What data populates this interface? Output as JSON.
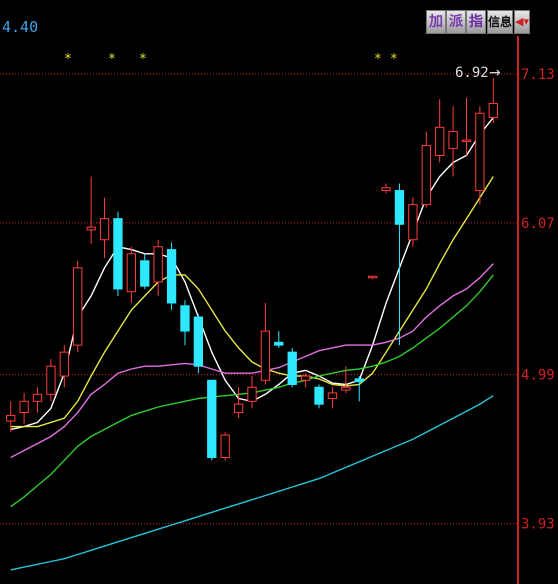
{
  "chart_data": {
    "type": "candlestick",
    "corner_value": "4.40",
    "y_ticks": [
      "7.13",
      "6.07",
      "4.99",
      "3.93"
    ],
    "ylim": [
      3.5,
      7.4
    ],
    "price_marker": "6.92",
    "star_marks": [
      "*",
      "*",
      "*",
      "*",
      "*"
    ],
    "candles": [
      {
        "o": 4.66,
        "h": 4.8,
        "l": 4.58,
        "c": 4.7
      },
      {
        "o": 4.72,
        "h": 4.86,
        "l": 4.64,
        "c": 4.8
      },
      {
        "o": 4.8,
        "h": 4.9,
        "l": 4.72,
        "c": 4.85
      },
      {
        "o": 4.85,
        "h": 5.1,
        "l": 4.8,
        "c": 5.05
      },
      {
        "o": 4.98,
        "h": 5.2,
        "l": 4.9,
        "c": 5.15
      },
      {
        "o": 5.2,
        "h": 5.8,
        "l": 5.15,
        "c": 5.75
      },
      {
        "o": 6.02,
        "h": 6.4,
        "l": 5.92,
        "c": 6.04
      },
      {
        "o": 5.95,
        "h": 6.25,
        "l": 5.82,
        "c": 6.1
      },
      {
        "o": 6.1,
        "h": 6.15,
        "l": 5.55,
        "c": 5.6
      },
      {
        "o": 5.58,
        "h": 5.9,
        "l": 5.5,
        "c": 5.85
      },
      {
        "o": 5.8,
        "h": 5.85,
        "l": 5.6,
        "c": 5.62
      },
      {
        "o": 5.65,
        "h": 5.95,
        "l": 5.55,
        "c": 5.9
      },
      {
        "o": 5.88,
        "h": 5.93,
        "l": 5.45,
        "c": 5.5
      },
      {
        "o": 5.48,
        "h": 5.52,
        "l": 5.2,
        "c": 5.3
      },
      {
        "o": 5.4,
        "h": 5.42,
        "l": 5.0,
        "c": 5.05
      },
      {
        "o": 4.95,
        "h": 4.95,
        "l": 4.38,
        "c": 4.4
      },
      {
        "o": 4.4,
        "h": 4.58,
        "l": 4.38,
        "c": 4.56
      },
      {
        "o": 4.72,
        "h": 4.9,
        "l": 4.68,
        "c": 4.78
      },
      {
        "o": 4.8,
        "h": 4.98,
        "l": 4.75,
        "c": 4.9
      },
      {
        "o": 4.95,
        "h": 5.5,
        "l": 4.92,
        "c": 5.3
      },
      {
        "o": 5.22,
        "h": 5.3,
        "l": 5.18,
        "c": 5.2
      },
      {
        "o": 5.15,
        "h": 5.18,
        "l": 4.9,
        "c": 4.92
      },
      {
        "o": 4.95,
        "h": 5.0,
        "l": 4.9,
        "c": 4.98
      },
      {
        "o": 4.9,
        "h": 4.92,
        "l": 4.75,
        "c": 4.78
      },
      {
        "o": 4.82,
        "h": 4.9,
        "l": 4.75,
        "c": 4.86
      },
      {
        "o": 4.88,
        "h": 5.05,
        "l": 4.86,
        "c": 4.9
      },
      {
        "o": 4.96,
        "h": 4.98,
        "l": 4.8,
        "c": 4.94
      },
      {
        "o": 5.68,
        "h": 5.69,
        "l": 5.67,
        "c": 5.69
      },
      {
        "o": 6.3,
        "h": 6.35,
        "l": 6.28,
        "c": 6.32
      },
      {
        "o": 6.3,
        "h": 6.35,
        "l": 5.2,
        "c": 6.06
      },
      {
        "o": 5.95,
        "h": 6.25,
        "l": 5.9,
        "c": 6.2
      },
      {
        "o": 6.2,
        "h": 6.72,
        "l": 6.18,
        "c": 6.62
      },
      {
        "o": 6.55,
        "h": 6.95,
        "l": 6.5,
        "c": 6.75
      },
      {
        "o": 6.6,
        "h": 6.9,
        "l": 6.4,
        "c": 6.72
      },
      {
        "o": 6.65,
        "h": 6.96,
        "l": 6.55,
        "c": 6.66
      },
      {
        "o": 6.3,
        "h": 6.9,
        "l": 6.2,
        "c": 6.85
      },
      {
        "o": 6.82,
        "h": 7.1,
        "l": 6.78,
        "c": 6.92
      }
    ],
    "series": [
      {
        "color": "#ffffff",
        "values": [
          4.6,
          4.62,
          4.65,
          4.75,
          5.0,
          5.4,
          5.55,
          5.75,
          5.9,
          5.88,
          5.85,
          5.85,
          5.82,
          5.65,
          5.4,
          5.15,
          4.95,
          4.82,
          4.8,
          4.85,
          4.92,
          5.0,
          5.02,
          4.98,
          4.93,
          4.92,
          4.95,
          5.2,
          5.5,
          5.75,
          6.0,
          6.25,
          6.4,
          6.5,
          6.55,
          6.7,
          6.82
        ]
      },
      {
        "color": "#e6e640",
        "values": [
          4.62,
          4.62,
          4.62,
          4.65,
          4.68,
          4.8,
          4.98,
          5.15,
          5.3,
          5.45,
          5.55,
          5.65,
          5.7,
          5.7,
          5.6,
          5.45,
          5.3,
          5.18,
          5.08,
          5.03,
          5.0,
          4.98,
          4.98,
          4.96,
          4.92,
          4.91,
          4.92,
          5.0,
          5.15,
          5.3,
          5.45,
          5.6,
          5.78,
          5.95,
          6.1,
          6.25,
          6.4
        ]
      },
      {
        "color": "#e070e0",
        "values": [
          4.4,
          4.45,
          4.5,
          4.55,
          4.62,
          4.72,
          4.85,
          4.92,
          5.0,
          5.03,
          5.05,
          5.05,
          5.06,
          5.07,
          5.06,
          5.03,
          5.0,
          5.0,
          5.0,
          5.02,
          5.04,
          5.08,
          5.12,
          5.16,
          5.18,
          5.2,
          5.2,
          5.2,
          5.22,
          5.25,
          5.3,
          5.4,
          5.48,
          5.55,
          5.6,
          5.68,
          5.78
        ]
      },
      {
        "color": "#2ecc2e",
        "values": [
          4.05,
          4.12,
          4.2,
          4.28,
          4.38,
          4.48,
          4.55,
          4.6,
          4.65,
          4.7,
          4.73,
          4.76,
          4.78,
          4.8,
          4.82,
          4.83,
          4.84,
          4.85,
          4.86,
          4.88,
          4.9,
          4.93,
          4.95,
          4.98,
          5.0,
          5.02,
          5.03,
          5.05,
          5.08,
          5.12,
          5.18,
          5.25,
          5.32,
          5.4,
          5.48,
          5.58,
          5.7
        ]
      },
      {
        "color": "#27c3d8",
        "values": [
          3.6,
          3.62,
          3.64,
          3.66,
          3.68,
          3.71,
          3.74,
          3.77,
          3.8,
          3.83,
          3.86,
          3.89,
          3.92,
          3.95,
          3.98,
          4.01,
          4.04,
          4.07,
          4.1,
          4.13,
          4.16,
          4.19,
          4.22,
          4.25,
          4.29,
          4.33,
          4.37,
          4.41,
          4.45,
          4.49,
          4.53,
          4.58,
          4.63,
          4.68,
          4.73,
          4.78,
          4.84
        ]
      }
    ]
  },
  "toolbar": {
    "btn1": "加",
    "btn2": "派",
    "btn3": "指",
    "btn4": "信息"
  },
  "colors": {
    "up": "#ff3c3c",
    "down": "#2ee8ff",
    "axis": "#cc2222",
    "label": "#cc2222",
    "corner": "#3fa3e6",
    "star": "#e6e640"
  }
}
